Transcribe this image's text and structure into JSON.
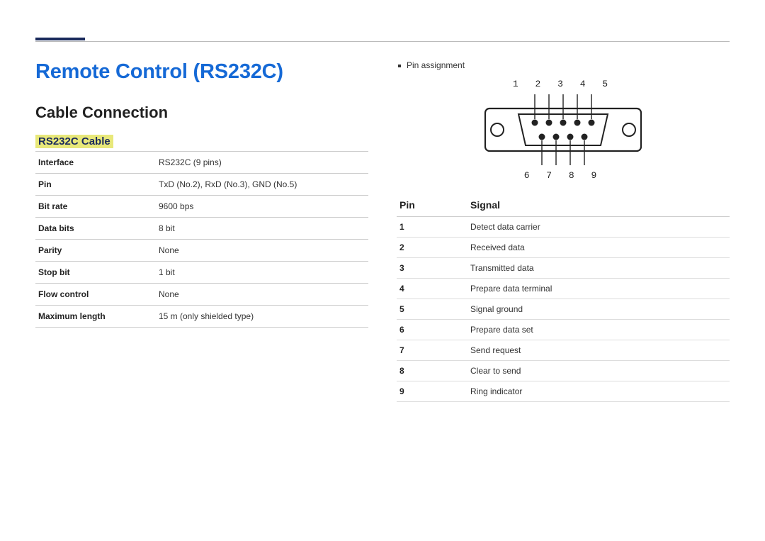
{
  "header": {
    "page_title": "Remote Control (RS232C)",
    "section_title": "Cable Connection",
    "subsection_title": "RS232C Cable"
  },
  "spec_table": [
    {
      "key": "Interface",
      "val": "RS232C (9 pins)"
    },
    {
      "key": "Pin",
      "val": "TxD (No.2), RxD (No.3), GND (No.5)"
    },
    {
      "key": "Bit rate",
      "val": "9600 bps"
    },
    {
      "key": "Data bits",
      "val": "8 bit"
    },
    {
      "key": "Parity",
      "val": "None"
    },
    {
      "key": "Stop bit",
      "val": "1 bit"
    },
    {
      "key": "Flow control",
      "val": "None"
    },
    {
      "key": "Maximum length",
      "val": "15 m (only shielded type)"
    }
  ],
  "right": {
    "bullet": "Pin assignment",
    "top_pin_labels": "1 2 3 4 5",
    "bottom_pin_labels": "6 7 8 9",
    "table_head_pin": "Pin",
    "table_head_signal": "Signal",
    "pins": [
      {
        "n": "1",
        "sig": "Detect data carrier"
      },
      {
        "n": "2",
        "sig": "Received data"
      },
      {
        "n": "3",
        "sig": "Transmitted data"
      },
      {
        "n": "4",
        "sig": "Prepare data terminal"
      },
      {
        "n": "5",
        "sig": "Signal ground"
      },
      {
        "n": "6",
        "sig": "Prepare data set"
      },
      {
        "n": "7",
        "sig": "Send request"
      },
      {
        "n": "8",
        "sig": "Clear to send"
      },
      {
        "n": "9",
        "sig": "Ring indicator"
      }
    ]
  }
}
